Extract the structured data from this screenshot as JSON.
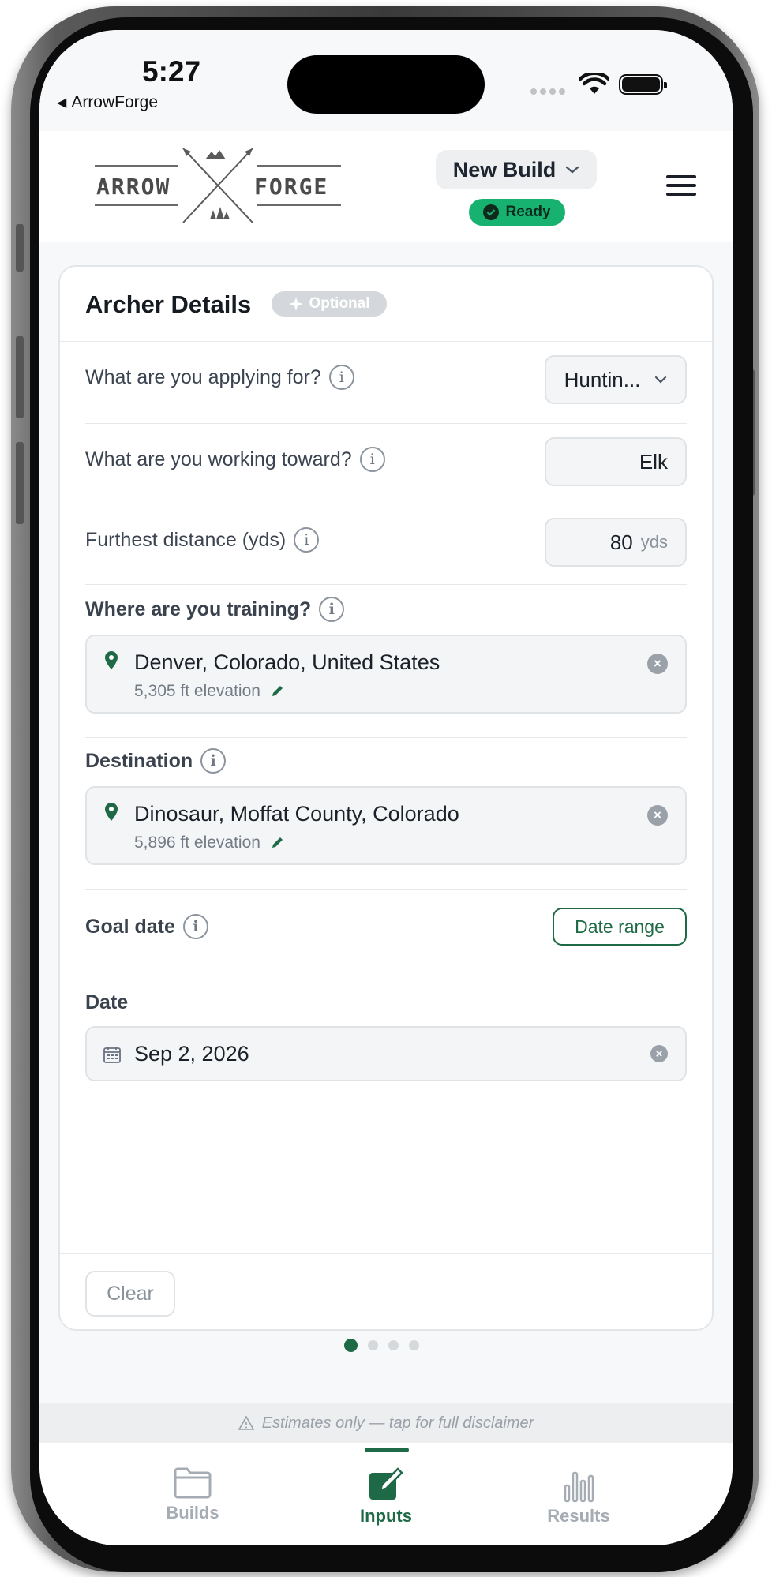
{
  "status_bar": {
    "time": "5:27",
    "back_app": "ArrowForge"
  },
  "header": {
    "logo_left": "ARROW",
    "logo_right": "FORGE",
    "build_select": "New Build",
    "status_badge": "Ready"
  },
  "card": {
    "title": "Archer Details",
    "badge": "Optional",
    "applying_for": {
      "label": "What are you applying for?",
      "value": "Huntin..."
    },
    "working_toward": {
      "label": "What are you working toward?",
      "value": "Elk"
    },
    "furthest_distance": {
      "label": "Furthest distance (yds)",
      "value": "80",
      "unit": "yds"
    },
    "training": {
      "label": "Where are you training?",
      "location": "Denver, Colorado, United States",
      "elevation": "5,305 ft elevation"
    },
    "destination": {
      "label": "Destination",
      "location": "Dinosaur, Moffat County, Colorado",
      "elevation": "5,896 ft elevation"
    },
    "goal_date": {
      "label": "Goal date",
      "range_button": "Date range",
      "date_label": "Date",
      "date_value": "Sep 2, 2026"
    },
    "clear_button": "Clear"
  },
  "pager": {
    "total": 4,
    "active": 1
  },
  "disclaimer": "Estimates only — tap for full disclaimer",
  "tabs": [
    {
      "label": "Builds",
      "icon": "folder-icon"
    },
    {
      "label": "Inputs",
      "icon": "edit-icon"
    },
    {
      "label": "Results",
      "icon": "bar-chart-icon"
    }
  ],
  "colors": {
    "accent": "#1f6a46",
    "ready": "#17b26f",
    "badge_gray": "#d4d7db"
  }
}
